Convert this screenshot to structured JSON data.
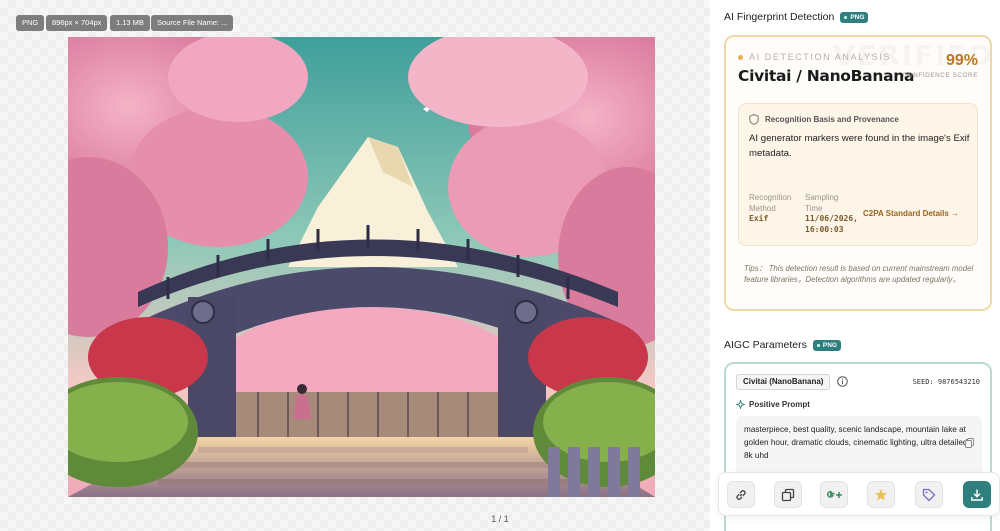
{
  "viewer": {
    "chips": [
      "PNG",
      "896px × 704px",
      "1.13 MB",
      "Source File Name: ..."
    ],
    "pager": "1 / 1",
    "image_alt": "Anime illustration of an arched bridge under cherry blossom trees with a snow-capped mountain"
  },
  "detection": {
    "section_title": "AI Fingerprint Detection",
    "badge": "PNG",
    "watermark": "VERIFIED",
    "analysis_label": "AI DETECTION ANALYSIS",
    "name": "Civitai / NanoBanana",
    "confidence": "99%",
    "confidence_label": "CONFIDENCE SCORE",
    "basis_title": "Recognition Basis and Provenance",
    "basis_text": "AI generator markers were found in the image's Exif metadata.",
    "method_label": "Recognition Method",
    "method_value": "Exif",
    "time_label": "Sampling Time",
    "time_value": "11/06/2026, 16:00:03",
    "c2pa_link": "C2PA Standard Details →",
    "tips": "Tips： This detection result is based on current mainstream model feature libraries，Detection algorithms are updated regularly。"
  },
  "aigc": {
    "section_title": "AIGC Parameters",
    "badge": "PNG",
    "model": "Civitai (NanoBanana)",
    "seed": "SEED: 9876543210",
    "positive_title": "Positive Prompt",
    "positive_prompt": "masterpiece, best quality, scenic landscape, mountain lake at golden hour, dramatic clouds, cinematic lighting, ultra detailed, 8k uhd"
  },
  "toolbar": {
    "buttons": [
      "link-icon",
      "copy-icon",
      "google-plus-icon",
      "star-icon",
      "tag-icon",
      "download-icon"
    ]
  },
  "colors": {
    "accent_gold": "#b77a1e",
    "accent_teal": "#2f7f7e",
    "card_border_gold": "#f0d8a6",
    "card_border_teal": "#bcd9d3",
    "star": "#e9c25a"
  }
}
